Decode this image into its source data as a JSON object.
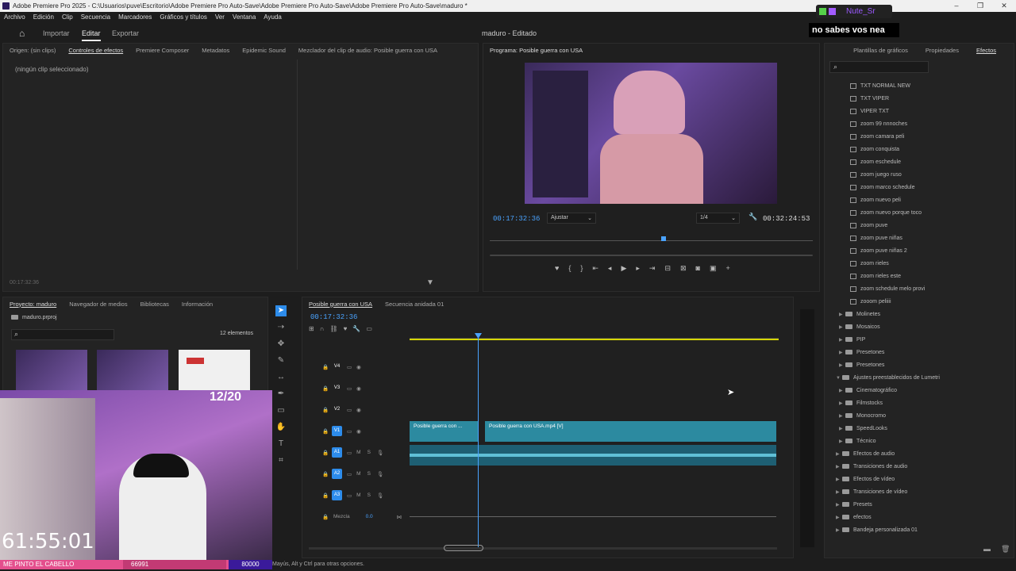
{
  "window": {
    "title": "Adobe Premiere Pro 2025 - C:\\Usuarios\\puve\\Escritorio\\Adobe Premiere Pro Auto-Save\\Adobe Premiere Pro Auto-Save\\Adobe Premiere Pro Auto-Save\\maduro *",
    "min": "–",
    "max": "❐",
    "close": "✕"
  },
  "menu": [
    "Archivo",
    "Edición",
    "Clip",
    "Secuencia",
    "Marcadores",
    "Gráficos y títulos",
    "Ver",
    "Ventana",
    "Ayuda"
  ],
  "header": {
    "home": "⌂",
    "tabs": [
      "Importar",
      "Editar",
      "Exportar"
    ],
    "project_title": "maduro - Editado"
  },
  "overlay": {
    "user": "Nute_Sr",
    "banner": "no sabes vos nea",
    "counter": "12/20",
    "clock": "61:55:01",
    "ticker_left": "ME PINTO EL CABELLO",
    "ticker_mid": "66991",
    "ticker_right": "80000"
  },
  "source_panel": {
    "tabs": [
      "Origen: (sin clips)",
      "Controles de efectos",
      "Premiere Composer",
      "Metadatos",
      "Epidemic Sound",
      "Mezclador del clip de audio: Posible guerra con USA"
    ],
    "no_clip": "(ningún clip seleccionado)",
    "timecode": "00:17:32:36"
  },
  "program": {
    "title": "Programa: Posible guerra con USA",
    "timecode": "00:17:32:36",
    "fit": "Ajustar",
    "res": "1/4",
    "duration": "00:32:24:53"
  },
  "right_panel": {
    "tabs": [
      "Plantillas de gráficos",
      "Propiedades",
      "Efectos"
    ],
    "presets": [
      "TXT NORMAL NEW",
      "TXT VIPER",
      "VIPER TXT",
      "zoom 99 nnnoches",
      "zoom camara peli",
      "zoom conquista",
      "zoom eschedule",
      "zoom juego ruso",
      "zoom marco schedule",
      "zoom nuevo peli",
      "zoom nuevo porque toco",
      "zoom puve",
      "zoom puve niñas",
      "zoom puve niñas 2",
      "zoom rieles",
      "zoom rieles este",
      "zoom schedule melo provi",
      "zooom peliiii"
    ],
    "folders1": [
      "Molinetes",
      "Mosaicos",
      "PIP",
      "Presetones",
      "Presetones"
    ],
    "lumetri": "Ajustes preestablecidos de Lumetri",
    "lumetri_children": [
      "Cinematográfico",
      "Filmstocks",
      "Monocromo",
      "SpeedLooks",
      "Técnico"
    ],
    "folders2": [
      "Efectos de audio",
      "Transiciones de audio",
      "Efectos de vídeo",
      "Transiciones de vídeo",
      "Presets",
      "efectos",
      "Bandeja personalizada 01"
    ]
  },
  "project": {
    "tabs": [
      "Proyecto: maduro",
      "Navegador de medios",
      "Bibliotecas",
      "Información"
    ],
    "file": "maduro.prproj",
    "count": "12 elementos"
  },
  "timeline": {
    "tabs": [
      "Posible guerra con USA",
      "Secuencia anidada 01"
    ],
    "timecode": "00:17:32:36",
    "video_tracks": [
      "V4",
      "V3",
      "V2",
      "V1"
    ],
    "audio_tracks": [
      "A1",
      "A2",
      "A3"
    ],
    "mix_label": "Mezcla",
    "mix_value": "0.0",
    "clip1": "Posible guerra con ...",
    "clip2": "Posible guerra con USA.mp4 [V]"
  },
  "status": "Mayús, Alt y Ctrl para otras opciones.",
  "colors": {
    "accent": "#2d8ceb",
    "timecode": "#4aa3ff",
    "clip": "#2c8aa0"
  }
}
